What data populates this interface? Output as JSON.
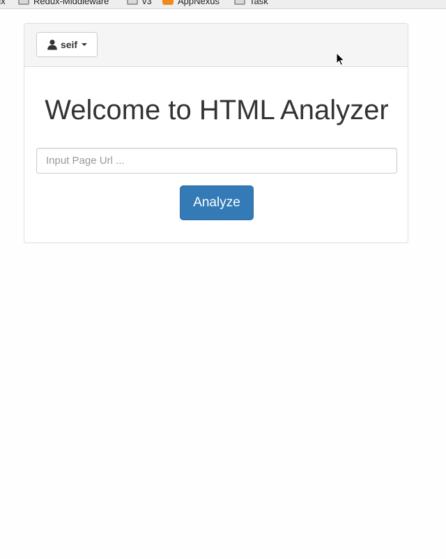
{
  "bookmarks": [
    {
      "label": "ux",
      "icon": "folder-icon"
    },
    {
      "label": "Redux-Middleware",
      "icon": "folder-icon"
    },
    {
      "label": "v3",
      "icon": "folder-icon"
    },
    {
      "label": "AppNexus",
      "icon": "appnexus-favicon"
    },
    {
      "label": "Task",
      "icon": "folder-icon"
    }
  ],
  "header": {
    "user_name": "seif",
    "user_icon": "user-icon"
  },
  "main": {
    "title": "Welcome to HTML Analyzer",
    "url_placeholder": "Input Page Url ...",
    "url_value": "",
    "analyze_label": "Analyze"
  },
  "colors": {
    "primary": "#337ab7",
    "panel_heading": "#f5f5f5",
    "border": "#dddddd"
  }
}
